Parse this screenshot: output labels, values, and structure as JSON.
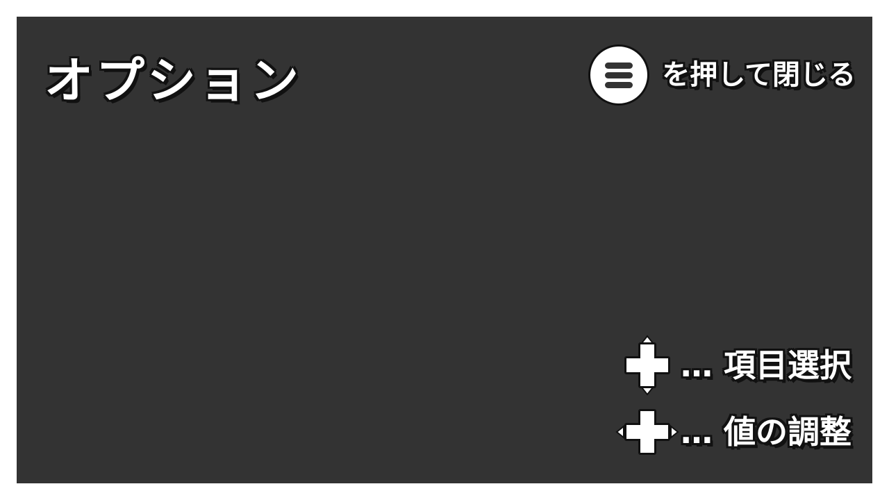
{
  "screen": {
    "title": "オプション",
    "close_hint": {
      "button_icon": "menu-button-icon",
      "text": "を押して閉じる"
    },
    "controls": [
      {
        "icon": "dpad-up-down-icon",
        "text": "… 項目選択"
      },
      {
        "icon": "dpad-left-right-icon",
        "text": "… 値の調整"
      }
    ]
  },
  "colors": {
    "background": "#333333",
    "text": "#ffffff",
    "outline": "#111111"
  }
}
